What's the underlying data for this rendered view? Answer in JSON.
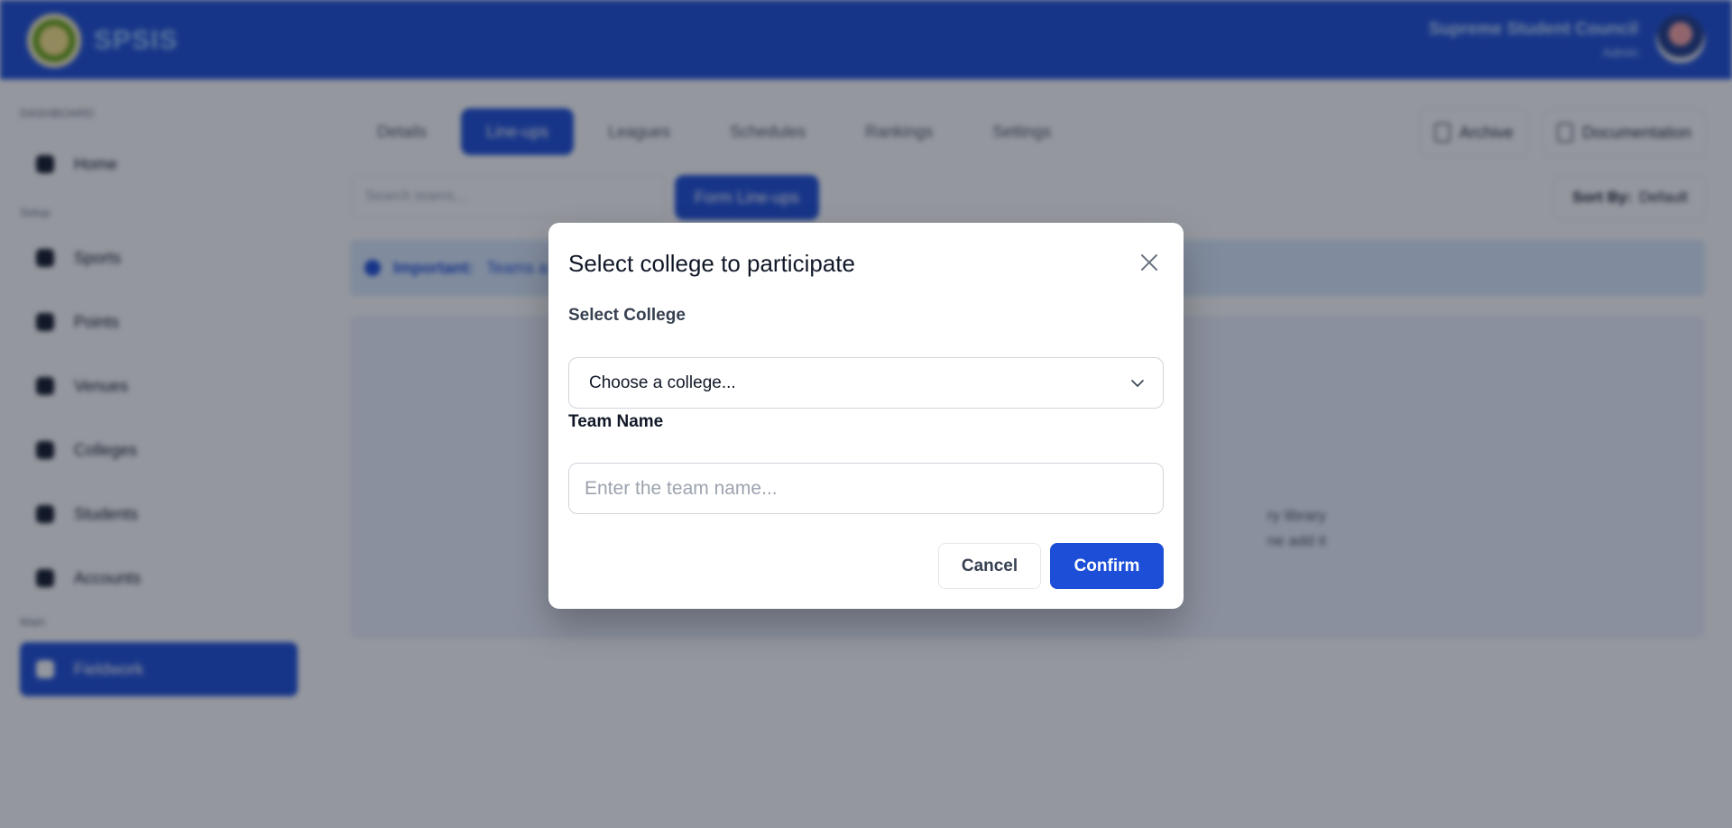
{
  "header": {
    "brand": "SPSIS",
    "user_name": "Supreme Student Council",
    "user_role": "Admin"
  },
  "sidebar": {
    "sections": [
      "DASHBOARD",
      "Setup",
      "Main"
    ],
    "items": [
      {
        "label": "Home",
        "icon": "home-icon"
      },
      {
        "label": "Sports",
        "icon": "trophy-icon"
      },
      {
        "label": "Points",
        "icon": "star-icon"
      },
      {
        "label": "Venues",
        "icon": "location-icon"
      },
      {
        "label": "Colleges",
        "icon": "building-icon"
      },
      {
        "label": "Students",
        "icon": "users-icon"
      },
      {
        "label": "Accounts",
        "icon": "shield-icon"
      },
      {
        "label": "Fieldwork",
        "icon": "flag-icon"
      }
    ]
  },
  "tabs": [
    "Details",
    "Line-ups",
    "Leagues",
    "Schedules",
    "Rankings",
    "Settings"
  ],
  "toolbar": {
    "archive": "Archive",
    "documentation": "Documentation",
    "search_placeholder": "Search teams...",
    "form_lineups": "Form Line-ups",
    "sort_label": "Sort By:",
    "sort_value": "Default"
  },
  "alert": {
    "title": "Important:",
    "text": "Teams a"
  },
  "empty_state": {
    "line1": "ry library",
    "line2": "ne add it"
  },
  "modal": {
    "title": "Select college to participate",
    "college_label": "Select College",
    "college_value": "Choose a college...",
    "team_label": "Team Name",
    "team_placeholder": "Enter the team name...",
    "cancel": "Cancel",
    "confirm": "Confirm"
  },
  "colors": {
    "primary": "#1d4ed8",
    "overlay": "rgba(17,24,39,0.45)"
  }
}
